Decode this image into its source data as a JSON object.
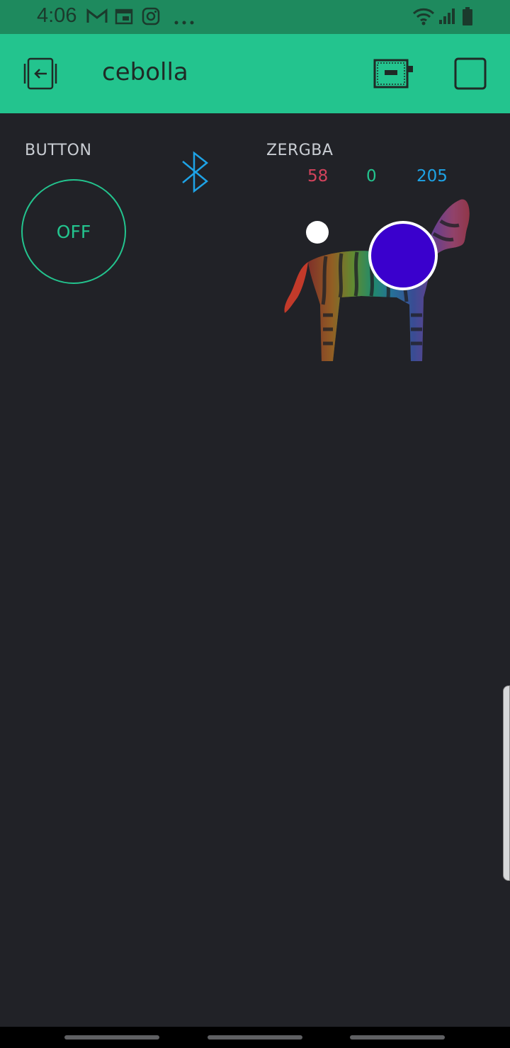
{
  "status_bar": {
    "time": "4:06",
    "left_icons": [
      "gmail-icon",
      "calendar-icon",
      "instagram-icon",
      "more-dots-icon"
    ],
    "right_icons": [
      "wifi-icon",
      "signal-icon",
      "battery-icon"
    ]
  },
  "app_bar": {
    "title": "cebolla",
    "background": "#23c48e"
  },
  "widgets": {
    "button": {
      "label": "BUTTON",
      "state_text": "OFF",
      "color": "#23c48e"
    },
    "bluetooth": {
      "icon": "bluetooth-icon",
      "color": "#1ea3e6"
    },
    "zergba": {
      "label": "ZERGBA",
      "r": "58",
      "g": "0",
      "b": "205",
      "r_color": "#d3435c",
      "g_color": "#23c48e",
      "b_color": "#1ea3e6",
      "selected_color": "#3a00cd"
    }
  }
}
